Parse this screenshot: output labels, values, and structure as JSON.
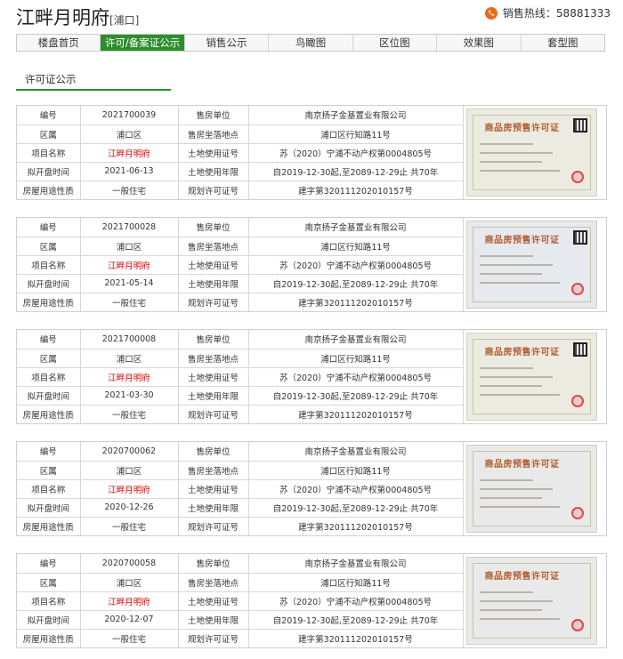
{
  "header": {
    "title": "江畔月明府",
    "district_tag": "[浦口]",
    "hotline_label": "销售热线：",
    "hotline_number": "58881333"
  },
  "nav": {
    "tabs": [
      {
        "label": "楼盘首页",
        "active": false
      },
      {
        "label": "许可/备案证公示",
        "active": true
      },
      {
        "label": "销售公示",
        "active": false
      },
      {
        "label": "鸟瞰图",
        "active": false
      },
      {
        "label": "区位图",
        "active": false
      },
      {
        "label": "效果图",
        "active": false
      },
      {
        "label": "套型图",
        "active": false
      }
    ]
  },
  "section_title": "许可证公示",
  "labels": {
    "no": "编号",
    "seller": "售房单位",
    "district": "区属",
    "location": "售房坐落地点",
    "project": "项目名称",
    "land_cert": "土地使用证号",
    "open_date": "拟开盘时间",
    "land_term": "土地使用年限",
    "usage": "房屋用途性质",
    "plan_permit": "规划许可证号"
  },
  "certificate_title": "商品房预售许可证",
  "records": [
    {
      "no": "2021700039",
      "seller": "南京扬子金基置业有限公司",
      "district": "浦口区",
      "location": "浦口区行知路11号",
      "project": "江畔月明府",
      "land_cert": "苏（2020）宁浦不动产权第0004805号",
      "open_date": "2021-06-13",
      "land_term": "自2019-12-30起,至2089-12-29止 共70年",
      "usage": "一般住宅",
      "plan_permit": "建字第320111202010157号"
    },
    {
      "no": "2021700028",
      "seller": "南京扬子金基置业有限公司",
      "district": "浦口区",
      "location": "浦口区行知路11号",
      "project": "江畔月明府",
      "land_cert": "苏（2020）宁浦不动产权第0004805号",
      "open_date": "2021-05-14",
      "land_term": "自2019-12-30起,至2089-12-29止 共70年",
      "usage": "一般住宅",
      "plan_permit": "建字第320111202010157号"
    },
    {
      "no": "2021700008",
      "seller": "南京扬子金基置业有限公司",
      "district": "浦口区",
      "location": "浦口区行知路11号",
      "project": "江畔月明府",
      "land_cert": "苏（2020）宁浦不动产权第0004805号",
      "open_date": "2021-03-30",
      "land_term": "自2019-12-30起,至2089-12-29止 共70年",
      "usage": "一般住宅",
      "plan_permit": "建字第320111202010157号"
    },
    {
      "no": "2020700062",
      "seller": "南京扬子金基置业有限公司",
      "district": "浦口区",
      "location": "浦口区行知路11号",
      "project": "江畔月明府",
      "land_cert": "苏（2020）宁浦不动产权第0004805号",
      "open_date": "2020-12-26",
      "land_term": "自2019-12-30起,至2089-12-29止 共70年",
      "usage": "一般住宅",
      "plan_permit": "建字第320111202010157号"
    },
    {
      "no": "2020700058",
      "seller": "南京扬子金基置业有限公司",
      "district": "浦口区",
      "location": "浦口区行知路11号",
      "project": "江畔月明府",
      "land_cert": "苏（2020）宁浦不动产权第0004805号",
      "open_date": "2020-12-07",
      "land_term": "自2019-12-30起,至2089-12-29止 共70年",
      "usage": "一般住宅",
      "plan_permit": "建字第320111202010157号"
    }
  ],
  "colors": {
    "accent": "#2c8e2c",
    "project_name": "#d40000",
    "phone_icon": "#e86b1c"
  }
}
